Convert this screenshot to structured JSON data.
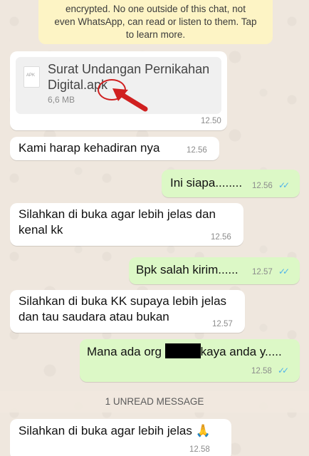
{
  "encryption_notice": {
    "line1": "encrypted. No one outside of this chat, not",
    "line2": "even WhatsApp, can read or listen to them. Tap",
    "line3": "to learn more."
  },
  "messages": [
    {
      "direction": "incoming",
      "type": "document",
      "file_name_line1": "Surat Undangan Pernikahan",
      "file_name_line2": "Digital.apk",
      "file_type_badge": "APK",
      "file_size": "6,6 MB",
      "time": "12.50"
    },
    {
      "direction": "incoming",
      "text": "Kami harap kehadiran nya",
      "time": "12.56"
    },
    {
      "direction": "outgoing",
      "text": "Ini siapa........",
      "time": "12.56",
      "status": "read"
    },
    {
      "direction": "incoming",
      "text_line1": "Silahkan di buka agar lebih jelas dan",
      "text_line2": "kenal kk",
      "time": "12.56"
    },
    {
      "direction": "outgoing",
      "text": "Bpk salah kirim......",
      "time": "12.57",
      "status": "read"
    },
    {
      "direction": "incoming",
      "text_line1": "Silahkan di buka KK supaya lebih jelas",
      "text_line2": "dan tau saudara atau bukan",
      "time": "12.57"
    },
    {
      "direction": "outgoing",
      "text_before_redaction": "Mana ada org",
      "text_after_redaction": "kaya anda y.....",
      "time": "12.58",
      "status": "read"
    },
    {
      "direction": "incoming",
      "text": "Silahkan di buka agar lebih jelas 🙏",
      "time": "12.58"
    }
  ],
  "unread_divider": "1 UNREAD MESSAGE",
  "colors": {
    "incoming_bubble": "#ffffff",
    "outgoing_bubble": "#dcf8c6",
    "read_ticks": "#4fb3ea",
    "annotation": "#d02020",
    "encryption_notice_bg": "#fdf4c5"
  },
  "icons": {
    "read_receipt": "double-check-icon",
    "annotation_arrow": "red-arrow-icon",
    "file": "apk-file-icon"
  }
}
